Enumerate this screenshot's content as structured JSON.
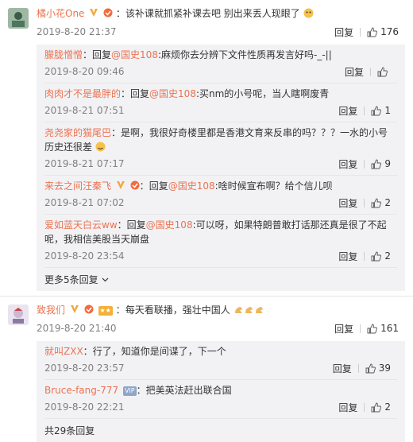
{
  "comments": [
    {
      "user": "橘小花One",
      "sep": "：",
      "text": "该补课就抓紧补课去吧 别出来丢人现眼了",
      "time": "2019-8-20 21:37",
      "reply_label": "回复",
      "likes": "176",
      "replies": [
        {
          "user": "朦胧憎憎",
          "sep": "：",
          "reply_word": "回复",
          "at": "@国史108",
          "text": ":麻烦你去分辨下文件性质再发言好吗-_-||",
          "time": "2019-8-20 09:46",
          "reply_label": "回复",
          "likes": ""
        },
        {
          "user": "肉肉才不是最胖的",
          "sep": "：",
          "reply_word": "回复",
          "at": "@国史108",
          "text": ":买nm的小号呢，当人瞎啊废青",
          "time": "2019-8-21 07:51",
          "reply_label": "回复",
          "likes": "1"
        },
        {
          "user": "尧尧家的猫尾巴",
          "sep": "：",
          "reply_word": "",
          "at": "",
          "text": "是啊，我很好奇楼里都是香港文育来反串的吗？？？一水的小号历史还很差",
          "time": "2019-8-21 07:17",
          "reply_label": "回复",
          "likes": "9"
        },
        {
          "user": "来去之间汪秦飞",
          "sep": "：",
          "reply_word": "回复",
          "at": "@国史108",
          "text": ":啥时候宣布啊？给个信儿呗",
          "time": "2019-8-21 07:02",
          "reply_label": "回复",
          "likes": "2"
        },
        {
          "user": "爱如蓝天白云ww",
          "sep": "：",
          "reply_word": "回复",
          "at": "@国史108",
          "text": ":可以呀，如果特朗普敢打话那还真是很了不起呢，我相信美股当天崩盘",
          "time": "2019-8-20 23:54",
          "reply_label": "回复",
          "likes": "2"
        }
      ],
      "more": "更多5条回复"
    },
    {
      "user": "致我们",
      "sep": "：",
      "text": "每天看联播，强壮中国人",
      "time": "2019-8-20 21:40",
      "reply_label": "回复",
      "likes": "161",
      "replies": [
        {
          "user": "就叫ZXX",
          "sep": "：",
          "reply_word": "",
          "at": "",
          "text": "行了，知道你是间谍了，下一个",
          "time": "2019-8-20 23:57",
          "reply_label": "回复",
          "likes": "39"
        },
        {
          "user": "Bruce-fang-777",
          "sep": "：",
          "reply_word": "",
          "at": "",
          "text": "把美英法赶出联合国",
          "time": "2019-8-20 22:21",
          "reply_label": "回复",
          "likes": "2"
        }
      ],
      "more": "共29条回复"
    }
  ],
  "colors": {
    "accent": "#eb7350",
    "reply_bg": "#f2f2f5",
    "time": "#808080"
  }
}
